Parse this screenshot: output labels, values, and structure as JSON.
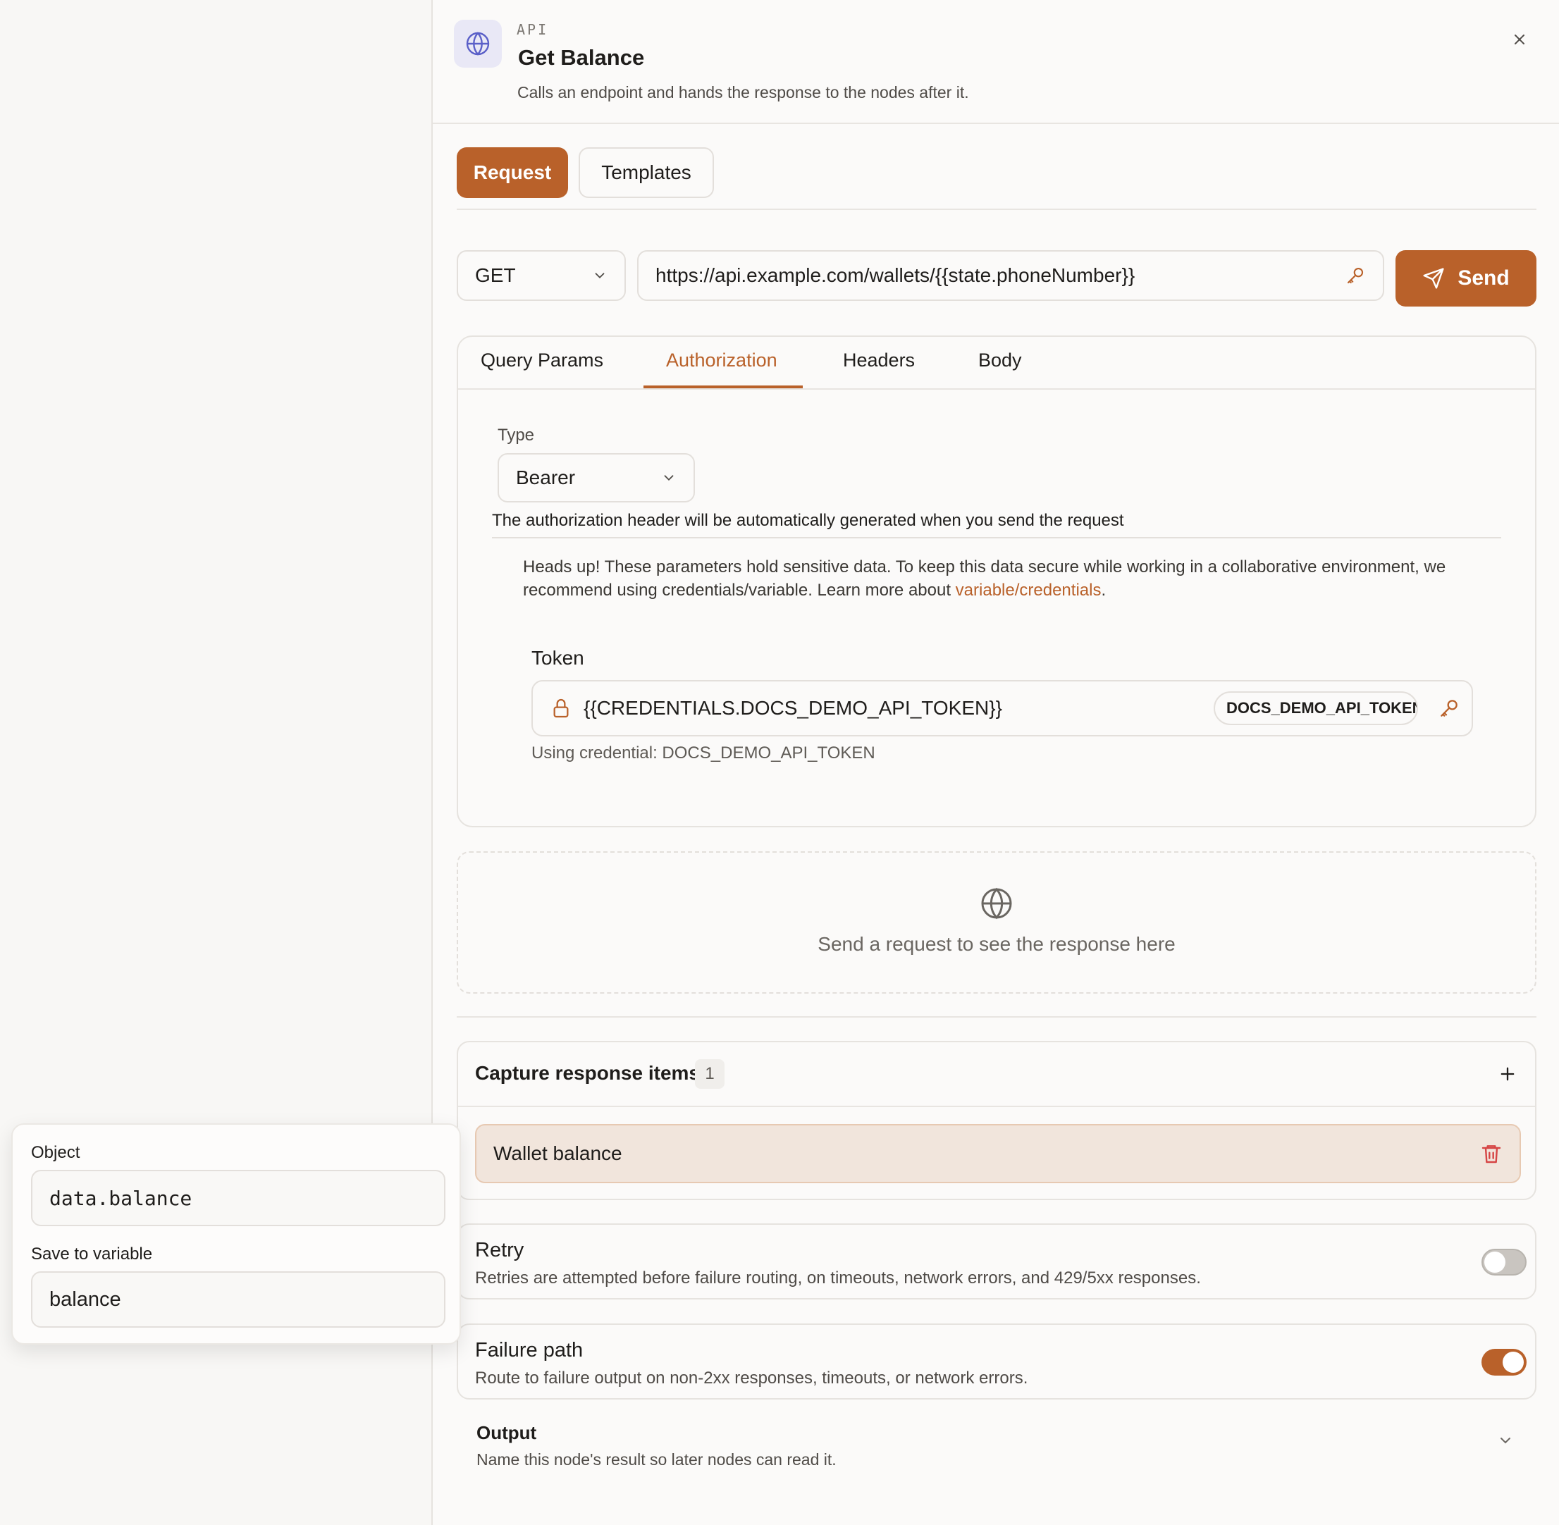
{
  "header": {
    "kicker": "API",
    "title": "Get Balance",
    "subtitle": "Calls an endpoint and hands the response to the nodes after it.",
    "icon": "globe-icon"
  },
  "top_tabs": {
    "request": "Request",
    "templates": "Templates"
  },
  "request": {
    "method": "GET",
    "url": "https://api.example.com/wallets/{{state.phoneNumber}}",
    "send_label": "Send"
  },
  "sub_tabs": {
    "query_params": "Query Params",
    "authorization": "Authorization",
    "headers": "Headers",
    "body": "Body"
  },
  "auth": {
    "type_label": "Type",
    "type_value": "Bearer",
    "note": "The authorization header will be automatically generated when you send the request",
    "headsup_text": "Heads up! These parameters hold sensitive data. To keep this data secure while working in a collaborative environment, we recommend using credentials/variable. Learn more about ",
    "headsup_link": "variable/credentials",
    "headsup_end": ".",
    "token_label": "Token",
    "token_value": "{{CREDENTIALS.DOCS_DEMO_API_TOKEN}}",
    "token_chip": "DOCS_DEMO_API_TOKEN",
    "credential_note": "Using credential: DOCS_DEMO_API_TOKEN"
  },
  "response": {
    "empty_text": "Send a request to see the response here"
  },
  "capture": {
    "title": "Capture response items",
    "count": "1",
    "items": [
      {
        "label": "Wallet balance"
      }
    ]
  },
  "retry": {
    "title": "Retry",
    "description": "Retries are attempted before failure routing, on timeouts, network errors, and 429/5xx responses.",
    "enabled": false
  },
  "failure": {
    "title": "Failure path",
    "description": "Route to failure output on non-2xx responses, timeouts, or network errors.",
    "enabled": true
  },
  "output": {
    "title": "Output",
    "description": "Name this node's result so later nodes can read it."
  },
  "popover": {
    "object_label": "Object",
    "object_value": "data.balance",
    "variable_label": "Save to variable",
    "variable_value": "balance"
  },
  "colors": {
    "accent": "#b9612a",
    "icon_bg": "#e9e8f6",
    "icon_stroke": "#5a5fc8",
    "delete": "#d64545"
  }
}
